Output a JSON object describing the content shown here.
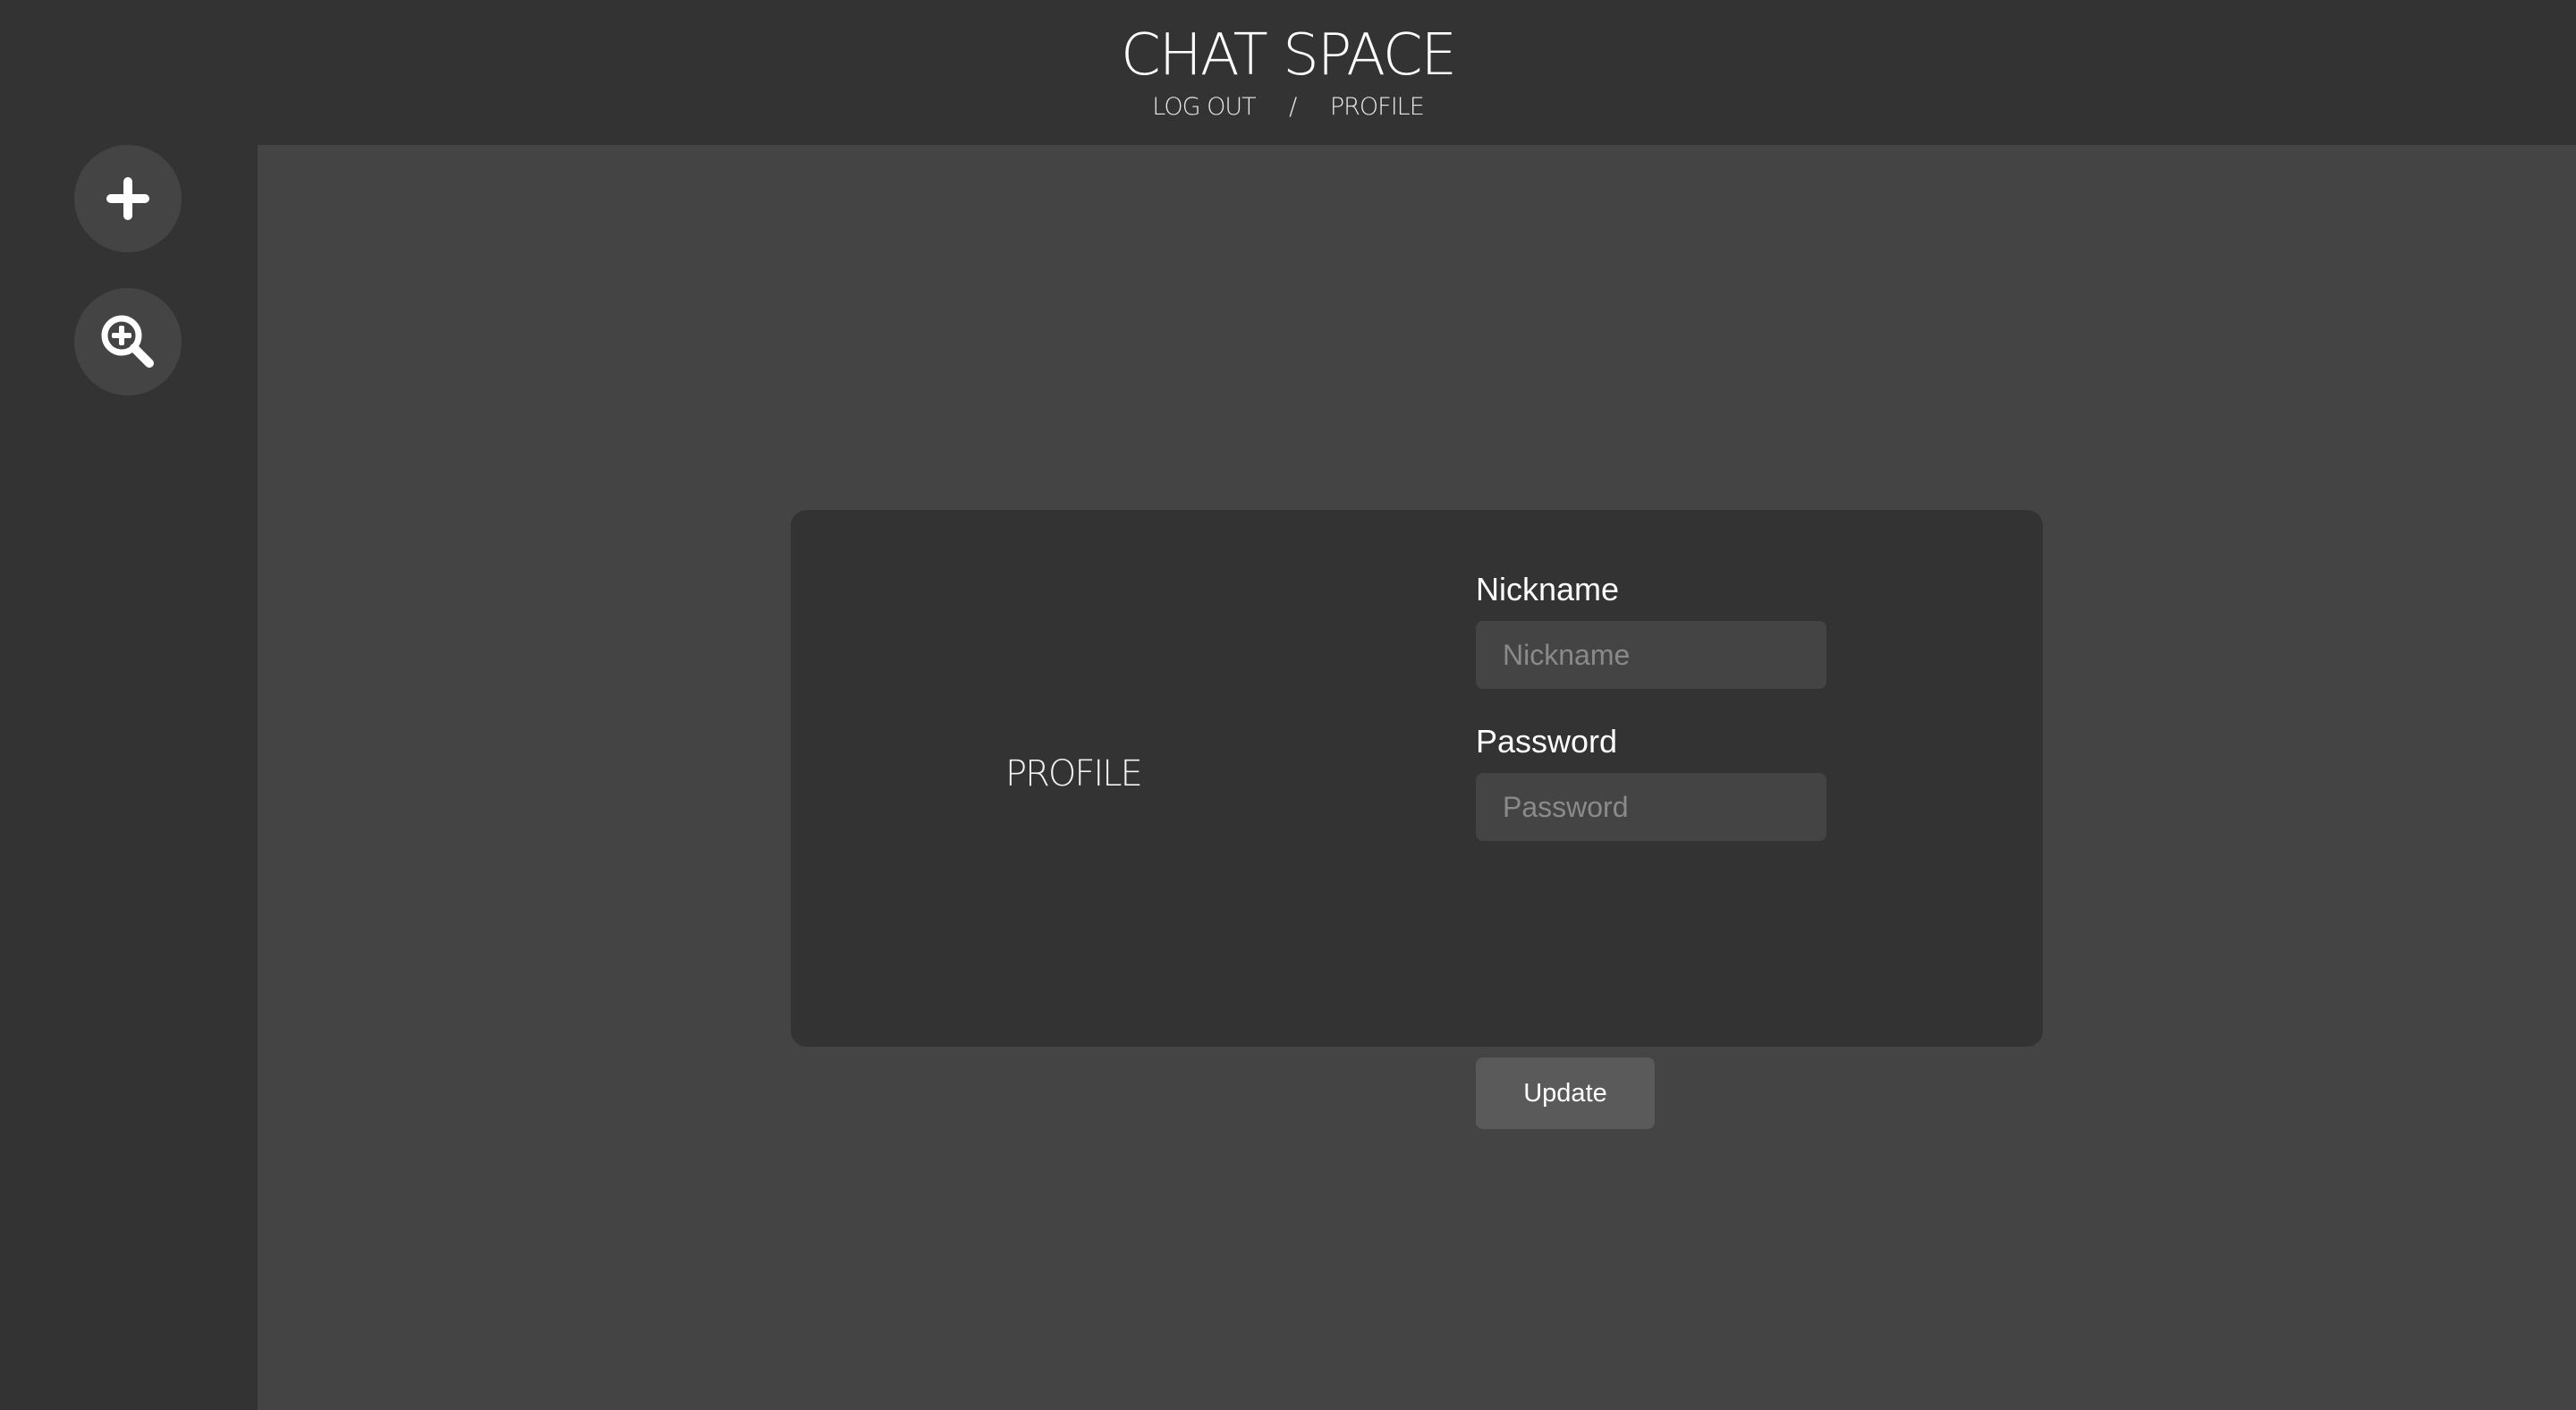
{
  "header": {
    "title": "CHAT SPACE",
    "nav": {
      "logout_label": "LOG OUT",
      "separator": "/",
      "profile_label": "PROFILE"
    }
  },
  "sidebar": {
    "buttons": [
      {
        "icon": "plus-icon"
      },
      {
        "icon": "zoom-in-icon"
      }
    ]
  },
  "profile_card": {
    "title": "PROFILE",
    "nickname": {
      "label": "Nickname",
      "placeholder": "Nickname",
      "value": ""
    },
    "password": {
      "label": "Password",
      "placeholder": "Password",
      "value": ""
    },
    "update_label": "Update"
  },
  "colors": {
    "header_bg": "#333333",
    "main_bg": "#444444",
    "card_bg": "#333333",
    "input_bg": "#444444",
    "button_bg": "#5a5a5a",
    "text": "#ffffff"
  }
}
